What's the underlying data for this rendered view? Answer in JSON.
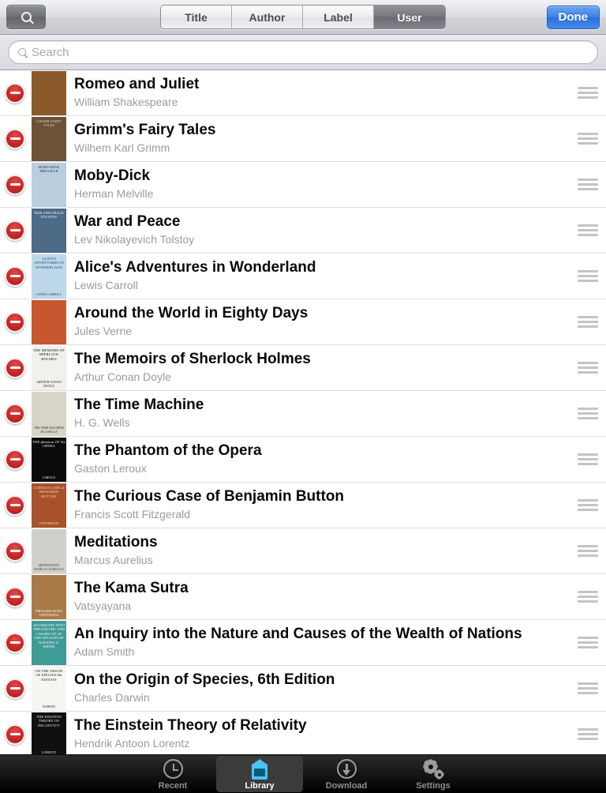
{
  "navbar": {
    "search_icon": "search-icon",
    "done_label": "Done",
    "segments": [
      {
        "label": "Title",
        "active": false
      },
      {
        "label": "Author",
        "active": false
      },
      {
        "label": "Label",
        "active": false
      },
      {
        "label": "User",
        "active": true
      }
    ]
  },
  "search": {
    "placeholder": "Search",
    "value": "",
    "icon": "search-icon"
  },
  "list": {
    "edit_mode": true,
    "delete_icon": "minus-circle-icon",
    "reorder_icon": "reorder-handle-icon",
    "rows": [
      {
        "title": "Romeo and Juliet",
        "author": "William Shakespeare",
        "cover": {
          "top": "",
          "bottom": "",
          "bg": "#8a5a2b",
          "fg": "#f6e3b8"
        }
      },
      {
        "title": "Grimm's Fairy Tales",
        "author": "Wilhem Karl Grimm",
        "cover": {
          "top": "GRIMM FAIRY TALES",
          "bottom": "",
          "bg": "#6d5238",
          "fg": "#e8d7a8"
        }
      },
      {
        "title": "Moby-Dick",
        "author": "Herman Melville",
        "cover": {
          "top": "MOBY-DICK MELVILLE",
          "bottom": "",
          "bg": "#b9cede",
          "fg": "#15212c"
        }
      },
      {
        "title": "War and Peace",
        "author": "Lev Nikolayevich Tolstoy",
        "cover": {
          "top": "WAR AND PEACE TOLSTOY",
          "bottom": "",
          "bg": "#4d6a86",
          "fg": "#ffffff"
        }
      },
      {
        "title": "Alice's Adventures in Wonderland",
        "author": "Lewis Carroll",
        "cover": {
          "top": "ALICE'S ADVENTURES IN WONDERLAND",
          "bottom": "LEWIS CARROLL",
          "bg": "#bcd7ea",
          "fg": "#1b3f63"
        }
      },
      {
        "title": "Around the World in Eighty Days",
        "author": "Jules Verne",
        "cover": {
          "top": "",
          "bottom": "",
          "bg": "#c7572e",
          "fg": "#f3d9a9"
        }
      },
      {
        "title": "The Memoirs of Sherlock Holmes",
        "author": "Arthur Conan Doyle",
        "cover": {
          "top": "THE MEMOIRS OF SHERLOCK HOLMES",
          "bottom": "ARTHUR CONAN DOYLE",
          "bg": "#f2f0ea",
          "fg": "#111111"
        }
      },
      {
        "title": "The Time Machine",
        "author": "H. G. Wells",
        "cover": {
          "top": "",
          "bottom": "THE TIME MACHINE H.G.WELLS",
          "bg": "#d8d4c8",
          "fg": "#2a2a2a"
        }
      },
      {
        "title": "The Phantom of the Opera",
        "author": "Gaston Leroux",
        "cover": {
          "top": "THE phantom OF the OPERA",
          "bottom": "LEROUX",
          "bg": "#0b0b0b",
          "fg": "#f0ede4"
        }
      },
      {
        "title": "The Curious Case of Benjamin Button",
        "author": "Francis Scott Fitzgerald",
        "cover": {
          "top": "CURIOUS CASE of BENJAMIN BUTTON",
          "bottom": "FITZGERALD",
          "bg": "#a8512a",
          "fg": "#f6e2b5"
        }
      },
      {
        "title": "Meditations",
        "author": "Marcus Aurelius",
        "cover": {
          "top": "",
          "bottom": "MEDITATIONS MARCUS AURELIUS",
          "bg": "#cfcfcb",
          "fg": "#3a3a3a"
        }
      },
      {
        "title": "The Kama Sutra",
        "author": "Vatsyayana",
        "cover": {
          "top": "",
          "bottom": "THE KAMA SUTRA VATSYAYANA",
          "bg": "#a87b46",
          "fg": "#ffffff"
        }
      },
      {
        "title": "An Inquiry into the Nature and Causes of the Wealth of Nations",
        "author": "Adam Smith",
        "cover": {
          "top": "AN INQUIRY INTO THE NATURE AND CAUSES OF OF THE WEALTH OF NATIONS A. SMITH",
          "bottom": "",
          "bg": "#3f9b96",
          "fg": "#ffffff"
        }
      },
      {
        "title": "On the Origin of Species, 6th Edition",
        "author": "Charles Darwin",
        "cover": {
          "top": "ON THE ORIGIN OF SPECIES 6th EDITION",
          "bottom": "DARWIN",
          "bg": "#f6f5f1",
          "fg": "#171717"
        }
      },
      {
        "title": "The Einstein Theory of Relativity",
        "author": "Hendrik Antoon Lorentz",
        "cover": {
          "top": "THE EINSTEIN THEORY OF RELATIVITY",
          "bottom": "LORENTZ",
          "bg": "#101010",
          "fg": "#e9e9e9"
        }
      }
    ]
  },
  "tabbar": {
    "items": [
      {
        "label": "Recent",
        "icon": "clock-icon",
        "active": false
      },
      {
        "label": "Library",
        "icon": "library-icon",
        "active": true
      },
      {
        "label": "Download",
        "icon": "download-icon",
        "active": false
      },
      {
        "label": "Settings",
        "icon": "gear-icon",
        "active": false
      }
    ]
  },
  "colors": {
    "accent_blue": "#3c82e8",
    "library_icon_blue": "#49c3f5",
    "delete_red": "#c82727",
    "author_gray": "#9b9b9b"
  }
}
